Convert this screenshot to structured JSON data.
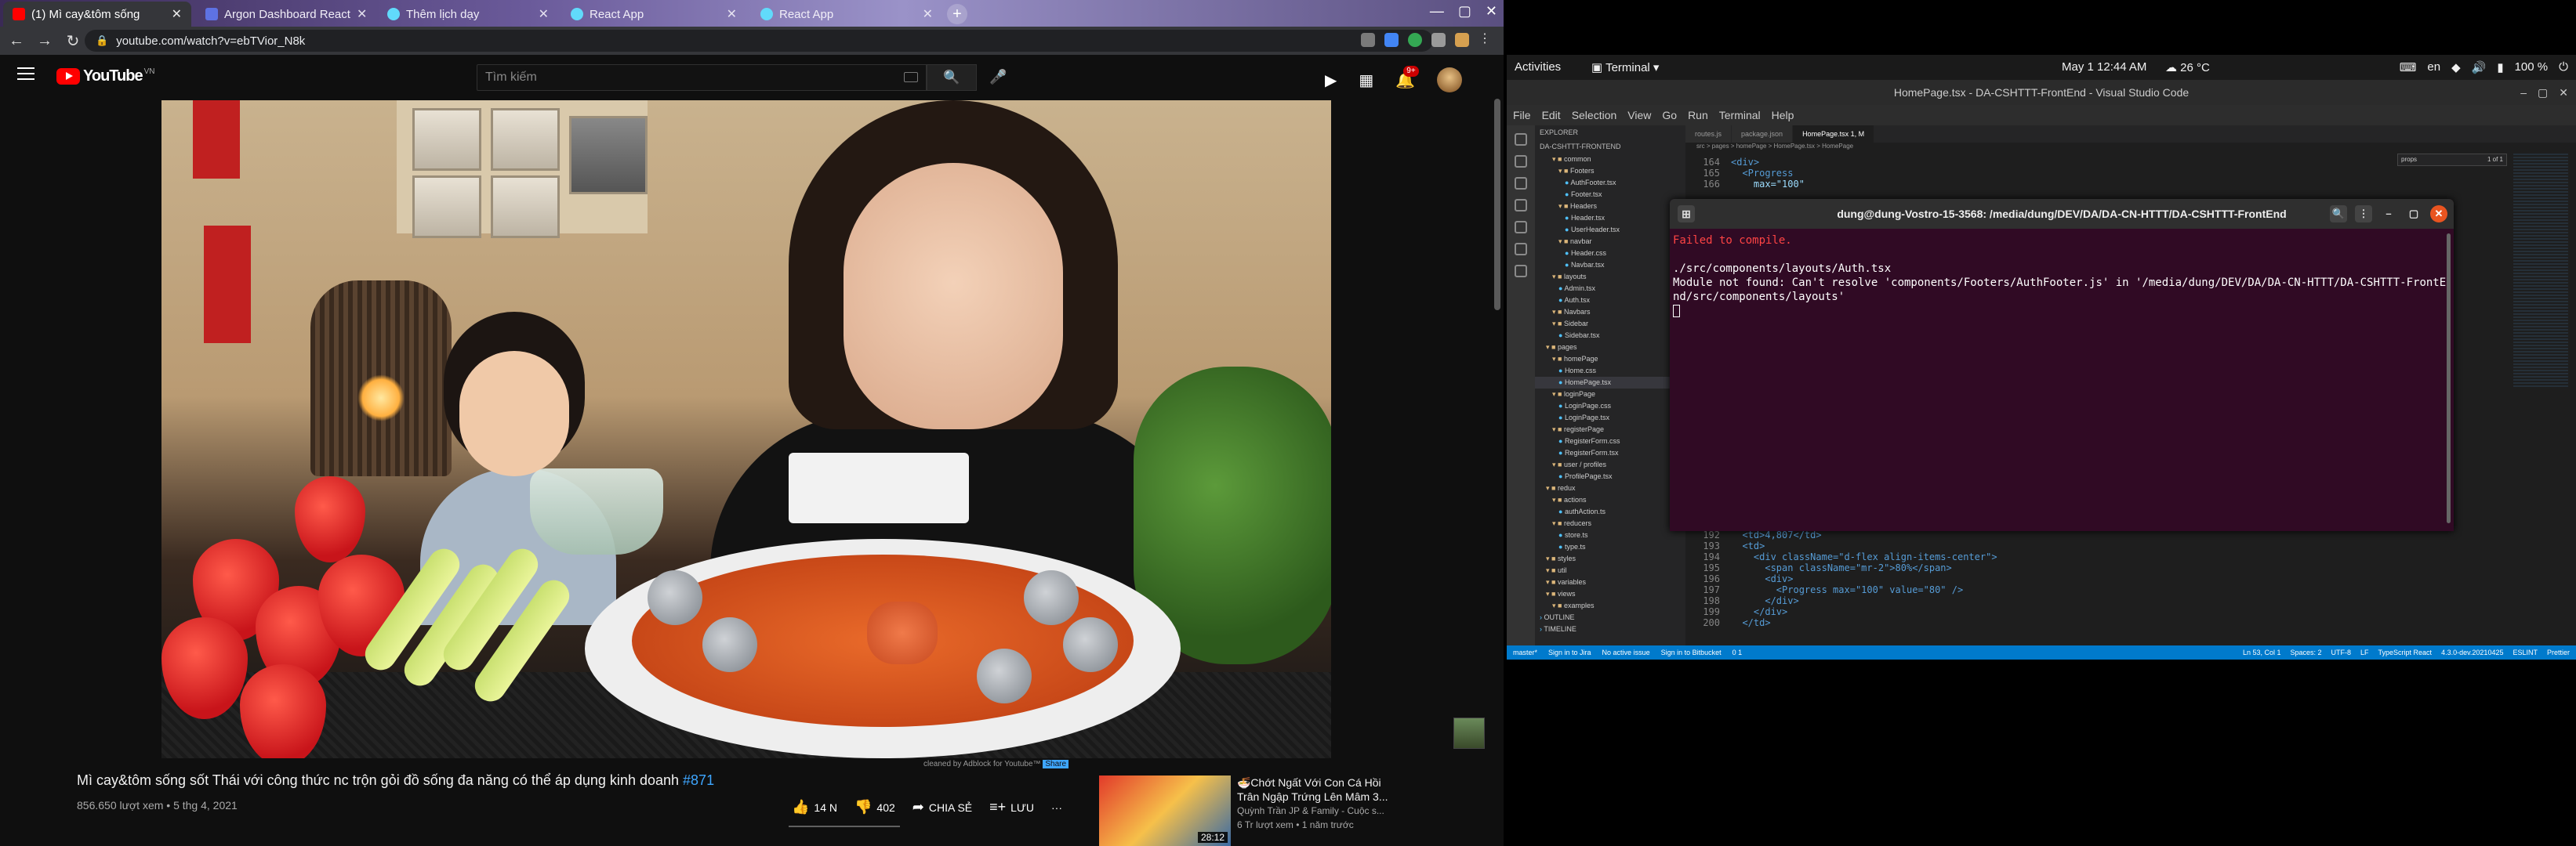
{
  "browser": {
    "tabs": [
      {
        "label": "(1) Mì cay&tôm sống",
        "active": true,
        "favicon": "youtube-icon",
        "color": "#ff0000"
      },
      {
        "label": "Argon Dashboard React",
        "active": false,
        "favicon": "argon-icon",
        "color": "#5e72e4"
      },
      {
        "label": "Thêm lịch dạy",
        "active": false,
        "favicon": "react-icon",
        "color": "#61dafb"
      },
      {
        "label": "React App",
        "active": false,
        "favicon": "react-icon",
        "color": "#61dafb"
      },
      {
        "label": "React App",
        "active": false,
        "favicon": "react-icon",
        "color": "#61dafb"
      }
    ],
    "url": "youtube.com/watch?v=ebTVior_N8k"
  },
  "youtube": {
    "logo_text": "YouTube",
    "country": "VN",
    "search_placeholder": "Tìm kiếm",
    "notification_count": "9+",
    "video": {
      "title": "Mì cay&tôm sống sốt Thái với công thức nc trộn gỏi đồ sống đa năng có thể áp dụng kinh doanh",
      "hashtag": "#871",
      "views_date": "856.650 lượt xem • 5 thg 4, 2021",
      "likes": "14 N",
      "dislikes": "402",
      "share_label": "CHIA SẺ",
      "save_label": "LƯU",
      "more": "···"
    },
    "sponsor_text": "cleaned by Adblock for Youtube™",
    "sponsor_link": "Share",
    "next_video": {
      "title": "🍜Chớt Ngất Với Con Cá Hồi Trân Ngập Trứng Lên Mâm 3...",
      "channel": "Quỳnh Trần JP & Family - Cuộc s...",
      "views": "6 Tr lượt xem • 1 năm trước",
      "duration": "28:12"
    }
  },
  "gnome": {
    "activities": "Activities",
    "app": "Terminal",
    "clock": "May 1  12:44 AM",
    "weather": "26 °C",
    "lang": "en",
    "battery": "100 %"
  },
  "vscode": {
    "title": "HomePage.tsx - DA-CSHTTT-FrontEnd - Visual Studio Code",
    "menu": [
      "File",
      "Edit",
      "Selection",
      "View",
      "Go",
      "Run",
      "Terminal",
      "Help"
    ],
    "explorer_title": "EXPLORER",
    "project": "DA-CSHTTT-FRONTEND",
    "tree": [
      {
        "label": "common",
        "type": "folder",
        "depth": 2
      },
      {
        "label": "Footers",
        "type": "folder",
        "depth": 3
      },
      {
        "label": "AuthFooter.tsx",
        "type": "file",
        "depth": 4
      },
      {
        "label": "Footer.tsx",
        "type": "file",
        "depth": 4
      },
      {
        "label": "Headers",
        "type": "folder",
        "depth": 3
      },
      {
        "label": "Header.tsx",
        "type": "file",
        "depth": 4
      },
      {
        "label": "UserHeader.tsx",
        "type": "file",
        "depth": 4
      },
      {
        "label": "navbar",
        "type": "folder",
        "depth": 3
      },
      {
        "label": "Header.css",
        "type": "file",
        "depth": 4
      },
      {
        "label": "Navbar.tsx",
        "type": "file",
        "depth": 4
      },
      {
        "label": "layouts",
        "type": "folder",
        "depth": 2
      },
      {
        "label": "Admin.tsx",
        "type": "file",
        "depth": 3
      },
      {
        "label": "Auth.tsx",
        "type": "file",
        "depth": 3
      },
      {
        "label": "Navbars",
        "type": "folder",
        "depth": 2
      },
      {
        "label": "Sidebar",
        "type": "folder",
        "depth": 2
      },
      {
        "label": "Sidebar.tsx",
        "type": "file",
        "depth": 3
      },
      {
        "label": "pages",
        "type": "folder",
        "depth": 1
      },
      {
        "label": "homePage",
        "type": "folder",
        "depth": 2
      },
      {
        "label": "Home.css",
        "type": "file",
        "depth": 3
      },
      {
        "label": "HomePage.tsx",
        "type": "file",
        "depth": 3,
        "selected": true
      },
      {
        "label": "loginPage",
        "type": "folder",
        "depth": 2
      },
      {
        "label": "LoginPage.css",
        "type": "file",
        "depth": 3
      },
      {
        "label": "LoginPage.tsx",
        "type": "file",
        "depth": 3
      },
      {
        "label": "registerPage",
        "type": "folder",
        "depth": 2
      },
      {
        "label": "RegisterForm.css",
        "type": "file",
        "depth": 3
      },
      {
        "label": "RegisterForm.tsx",
        "type": "file",
        "depth": 3
      },
      {
        "label": "user / profiles",
        "type": "folder",
        "depth": 2
      },
      {
        "label": "ProfilePage.tsx",
        "type": "file",
        "depth": 3
      },
      {
        "label": "redux",
        "type": "folder",
        "depth": 1
      },
      {
        "label": "actions",
        "type": "folder",
        "depth": 2
      },
      {
        "label": "authAction.ts",
        "type": "file",
        "depth": 3
      },
      {
        "label": "reducers",
        "type": "folder",
        "depth": 2
      },
      {
        "label": "store.ts",
        "type": "file",
        "depth": 3
      },
      {
        "label": "type.ts",
        "type": "file",
        "depth": 3
      },
      {
        "label": "styles",
        "type": "folder",
        "depth": 1
      },
      {
        "label": "util",
        "type": "folder",
        "depth": 1
      },
      {
        "label": "variables",
        "type": "folder",
        "depth": 1
      },
      {
        "label": "views",
        "type": "folder",
        "depth": 1
      },
      {
        "label": "examples",
        "type": "folder",
        "depth": 2
      },
      {
        "label": "OUTLINE",
        "type": "section",
        "depth": 0
      },
      {
        "label": "TIMELINE",
        "type": "section",
        "depth": 0
      }
    ],
    "tabs": [
      {
        "label": "routes.js",
        "active": false
      },
      {
        "label": "package.json",
        "active": false
      },
      {
        "label": "HomePage.tsx 1, M",
        "active": true
      }
    ],
    "breadcrumb": "src > pages > homePage > HomePage.tsx > HomePage",
    "code_top": [
      {
        "n": "164",
        "text": "<div>"
      },
      {
        "n": "165",
        "text": "  <Progress"
      },
      {
        "n": "166",
        "text": "    max=\"100\""
      }
    ],
    "code_bottom": [
      {
        "n": "192",
        "text": "  <td>4,807</td>"
      },
      {
        "n": "193",
        "text": "  <td>"
      },
      {
        "n": "194",
        "text": "    <div className=\"d-flex align-items-center\">"
      },
      {
        "n": "195",
        "text": "      <span className=\"mr-2\">80%</span>"
      },
      {
        "n": "196",
        "text": "      <div>"
      },
      {
        "n": "197",
        "text": "        <Progress max=\"100\" value=\"80\" />"
      },
      {
        "n": "198",
        "text": "      </div>"
      },
      {
        "n": "199",
        "text": "    </div>"
      },
      {
        "n": "200",
        "text": "  </td>"
      }
    ],
    "find_text": "props",
    "find_result": "1 of 1",
    "status_left": [
      "master*",
      "Sign in to Jira",
      "No active issue",
      "Sign in to Bitbucket",
      "0 1"
    ],
    "status_right": [
      "Ln 53, Col 1",
      "Spaces: 2",
      "UTF-8",
      "LF",
      "TypeScript React",
      "4.3.0-dev.20210425",
      "ESLINT",
      "Prettier"
    ]
  },
  "terminal": {
    "title": "dung@dung-Vostro-15-3568: /media/dung/DEV/DA/DA-CN-HTTT/DA-CSHTTT-FrontEnd",
    "lines": [
      {
        "text": "Failed to compile.",
        "error": true
      },
      {
        "text": "",
        "error": false
      },
      {
        "text": "./src/components/layouts/Auth.tsx",
        "error": false
      },
      {
        "text": "Module not found: Can't resolve 'components/Footers/AuthFooter.js' in '/media/dung/DEV/DA/DA-CN-HTTT/DA-CSHTTT-FrontEnd/src/components/layouts'",
        "error": false
      }
    ]
  }
}
